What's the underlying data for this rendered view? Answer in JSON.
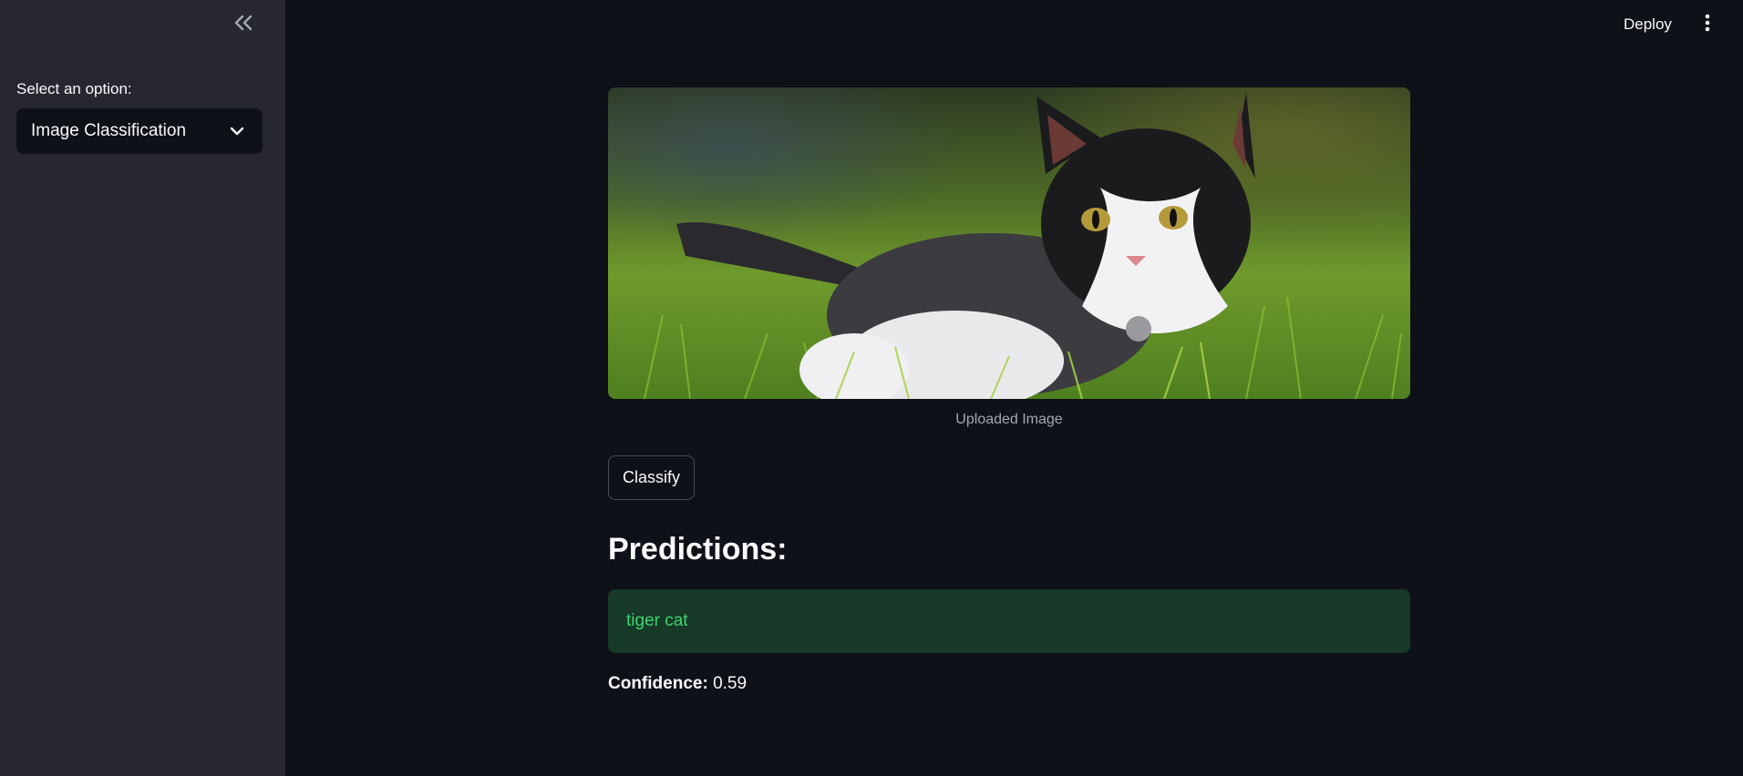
{
  "sidebar": {
    "collapse_icon": "double-chevron-left-icon",
    "select_label": "Select an option:",
    "selected_option": "Image Classification",
    "dropdown_icon": "chevron-down-icon"
  },
  "header": {
    "deploy_label": "Deploy",
    "menu_icon": "vertical-ellipsis-icon"
  },
  "main": {
    "image_caption": "Uploaded Image",
    "classify_label": "Classify",
    "predictions_heading": "Predictions:",
    "prediction": "tiger cat",
    "confidence_label": "Confidence:",
    "confidence_value": "0.59"
  },
  "colors": {
    "app_background": "#0e1117",
    "sidebar_background": "#262730",
    "success_background": "#173928",
    "success_text": "#3dd56d"
  }
}
